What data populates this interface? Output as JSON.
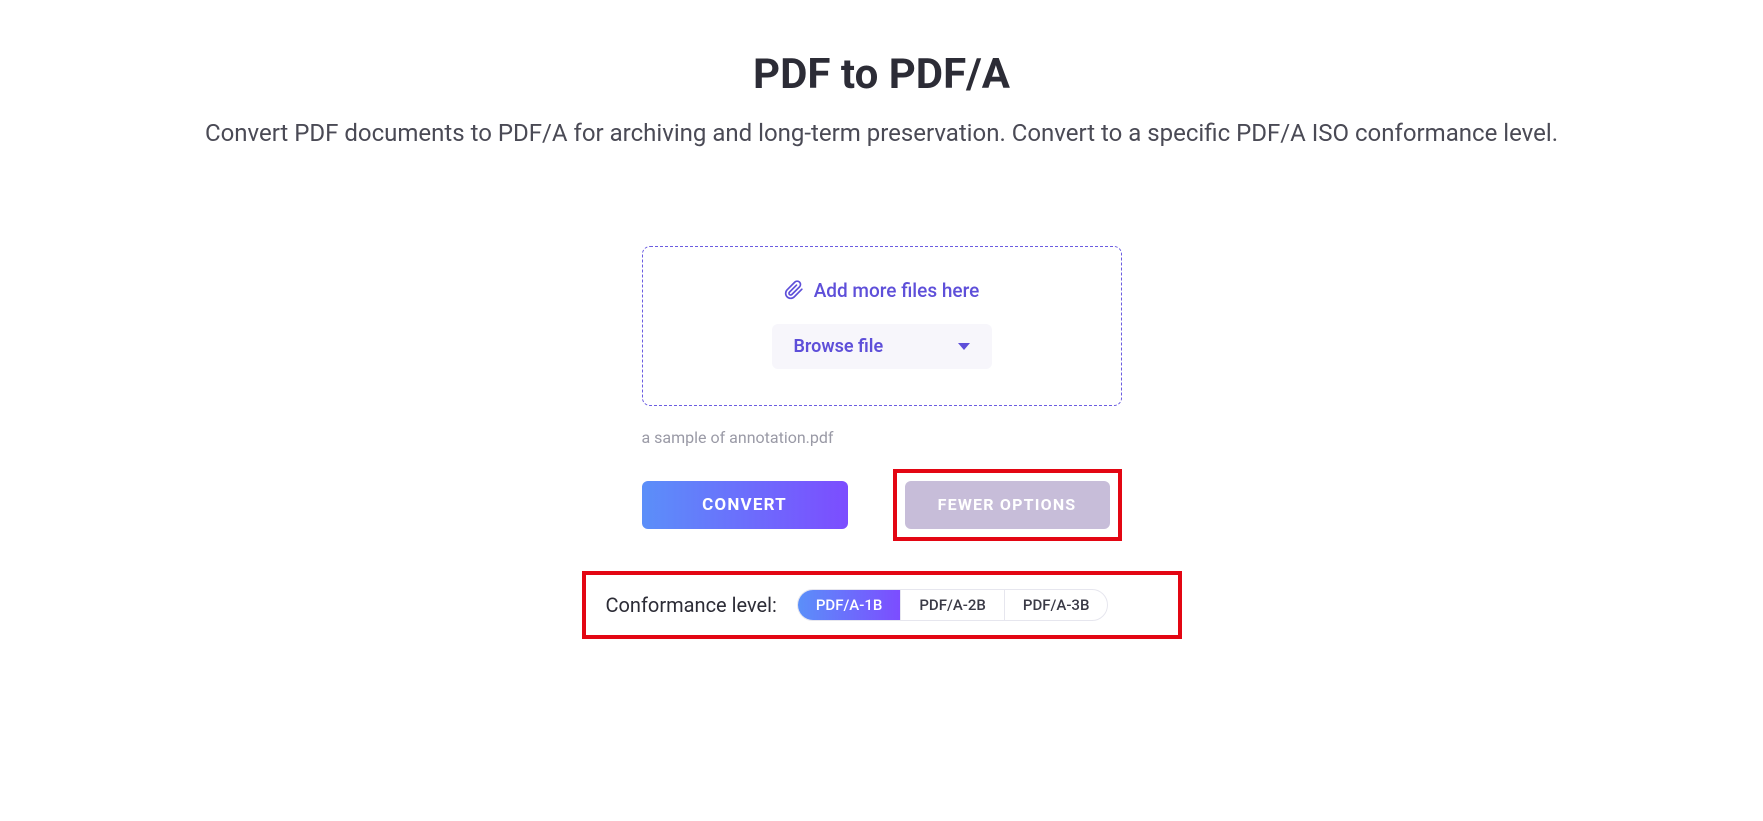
{
  "header": {
    "title": "PDF to PDF/A",
    "subtitle": "Convert PDF documents to PDF/A for archiving and long-term preservation. Convert to a specific PDF/A ISO conformance level."
  },
  "upload": {
    "add_files_text": "Add more files here",
    "browse_label": "Browse file"
  },
  "file": {
    "name": "a sample of annotation.pdf"
  },
  "actions": {
    "convert_label": "CONVERT",
    "fewer_options_label": "FEWER OPTIONS"
  },
  "conformance": {
    "label": "Conformance level:",
    "options": [
      {
        "label": "PDF/A-1B",
        "active": true
      },
      {
        "label": "PDF/A-2B",
        "active": false
      },
      {
        "label": "PDF/A-3B",
        "active": false
      }
    ]
  },
  "colors": {
    "accent_gradient_start": "#5b8ff9",
    "accent_gradient_end": "#7c4dff",
    "link": "#5e4fd9",
    "highlight_border": "#e30613",
    "muted_button": "#c7bdd9"
  }
}
